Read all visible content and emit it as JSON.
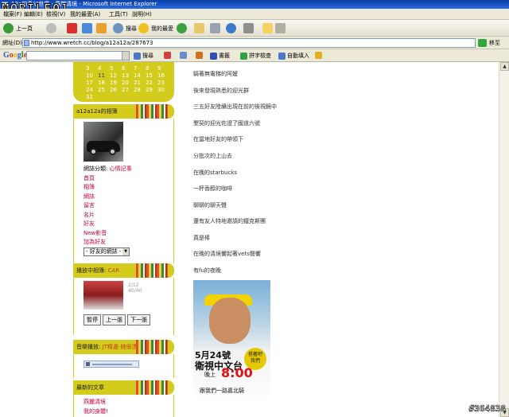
{
  "window": {
    "title": "12a的奇幻世界 - 燕麗清境 - Microsoft Internet Explorer",
    "watermark": "MOBILE01"
  },
  "menu": {
    "items": [
      "檔案(F)",
      "編輯(E)",
      "檢視(V)",
      "我的最愛(A)",
      "工具(T)",
      "說明(H)"
    ]
  },
  "toolbar": {
    "back_label": "上一頁",
    "search_label": "搜尋",
    "favorites_label": "我的最愛"
  },
  "address": {
    "label": "網址(D)",
    "url": "http://www.wretch.cc/blog/a12a12a/287673",
    "go_label": "移至"
  },
  "google": {
    "logo": "Google",
    "search_label": "搜尋",
    "pagerank_label": "書籤",
    "spell_label": "拼字檢查",
    "autofill_label": "自動填入"
  },
  "calendar": {
    "rows": [
      [
        "3",
        "4",
        "5",
        "6",
        "7",
        "8",
        "9"
      ],
      [
        "10",
        "11",
        "12",
        "13",
        "14",
        "15",
        "16"
      ],
      [
        "17",
        "18",
        "19",
        "20",
        "21",
        "22",
        "23"
      ],
      [
        "24",
        "25",
        "26",
        "27",
        "28",
        "29",
        "30"
      ],
      [
        "31"
      ]
    ]
  },
  "profile": {
    "title": "a12a12a的相簿",
    "category_label": "網誌分類:",
    "category_value": "心情記事",
    "links": [
      "首頁",
      "相簿",
      "網誌",
      "留言",
      "名片",
      "好友",
      "New影音",
      "加為好友"
    ],
    "friends_select": "- 好友的網誌 -"
  },
  "video": {
    "title_prefix": "播放中相簿:",
    "title_value": "CAR",
    "thumb_caption": "2/12\n40/40",
    "buttons": [
      "暫停",
      "上一張",
      "下一張"
    ]
  },
  "music": {
    "title_prefix": "音樂播放:",
    "title_value": "JT精選-她很漂亮"
  },
  "recent": {
    "title": "最新的文章",
    "items": [
      "燕麗清境",
      "我的身體!"
    ]
  },
  "post_lines": [
    "騎著無電梯的阿嬤",
    "後來發現熟悉的迎光群",
    "三五好友陸續出現在前的後視鏡中",
    "墾契的迎光佐證了國道六號",
    "在當地好友的帶領下",
    "分批次的上山去",
    "在晚的starbucks",
    "一杯香醇的咖啡",
    "聊聊的聊天聲",
    "還有友人特地邀請的鐵克斯團",
    "真是棒",
    "在晚的清境響起著vets聲響",
    "有fu的夜晚"
  ],
  "poster": {
    "line1": "5月24號",
    "line2": "衛視中文台",
    "line3": "晚上",
    "time": "8:00",
    "line4": "跟我們一路嘉北騎",
    "badge": "搭著吧\n我們"
  },
  "image_id": "#364838"
}
